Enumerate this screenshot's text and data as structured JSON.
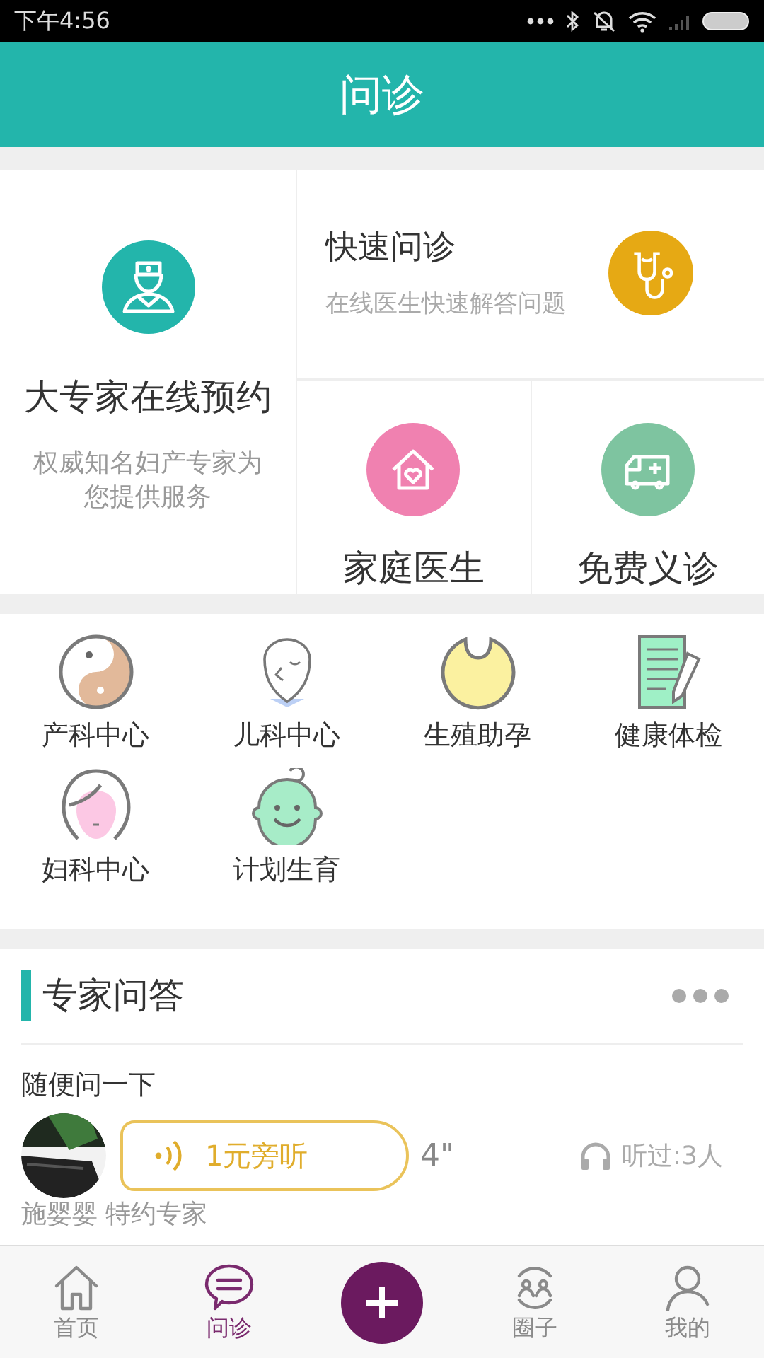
{
  "status_bar": {
    "time": "下午4:56"
  },
  "header": {
    "title": "问诊"
  },
  "featured": {
    "main": {
      "title": "大专家在线预约",
      "subtitle": "权威知名妇产专家为您提供服务"
    },
    "quick": {
      "title": "快速问诊",
      "subtitle": "在线医生快速解答问题"
    },
    "tiles": [
      {
        "kind": "house",
        "title": "家庭医生"
      },
      {
        "kind": "ambulance",
        "title": "免费义诊"
      }
    ]
  },
  "departments": [
    {
      "kind": "yinyang",
      "label": "产科中心"
    },
    {
      "kind": "face",
      "label": "儿科中心"
    },
    {
      "kind": "bib",
      "label": "生殖助孕"
    },
    {
      "kind": "checklist",
      "label": "健康体检"
    },
    {
      "kind": "woman",
      "label": "妇科中心"
    },
    {
      "kind": "baby",
      "label": "计划生育"
    }
  ],
  "qa": {
    "title": "专家问答",
    "question": "随便问一下",
    "answer": {
      "price_label": "1元旁听",
      "duration": "4\"",
      "listened": "听过:3人",
      "expert": "施婴婴 特约专家"
    }
  },
  "tabs": [
    {
      "kind": "home",
      "label": "首页",
      "selected": false
    },
    {
      "kind": "chat",
      "label": "问诊",
      "selected": true
    },
    {
      "kind": "plus",
      "selected": false
    },
    {
      "kind": "circle",
      "label": "圈子",
      "selected": false
    },
    {
      "kind": "person",
      "label": "我的",
      "selected": false
    }
  ]
}
